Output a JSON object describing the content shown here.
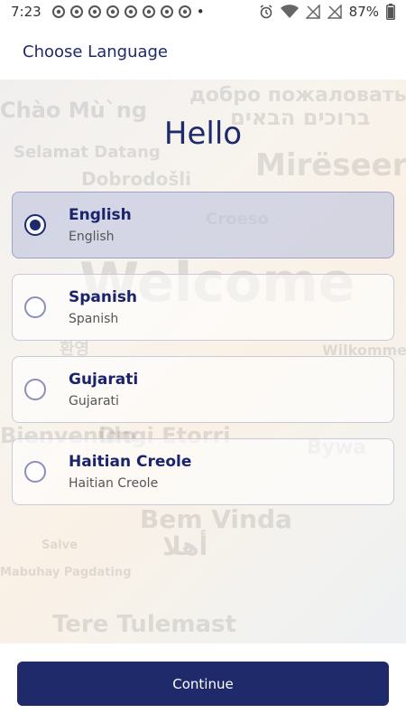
{
  "status_bar": {
    "time": "7:23",
    "battery": "87%",
    "notification_icons": [
      "chrome-icon",
      "chrome-icon",
      "chrome-icon",
      "chrome-icon",
      "chrome-icon",
      "chrome-icon",
      "chrome-icon",
      "chrome-icon"
    ],
    "more_dot": "•"
  },
  "header": {
    "title": "Choose Language"
  },
  "greeting": "Hello",
  "background_words": [
    "Welcome",
    "Bem Vinda",
    "Mirëseerdhët",
    "Dobrodošli",
    "Chào Mù`ng",
    "Selamat Datang",
    "Croeso",
    "Wilkommen",
    "Tere Tulemast",
    "Ongi Etorri",
    "Bienvenido",
    "Bywa",
    "Salve",
    "Mabuhay Pagdating",
    "добро пожаловать",
    "ברוכים הבאים",
    "أهلا",
    "환영"
  ],
  "languages": [
    {
      "name": "English",
      "native": "English",
      "selected": true
    },
    {
      "name": "Spanish",
      "native": "Spanish",
      "selected": false
    },
    {
      "name": "Gujarati",
      "native": "Gujarati",
      "selected": false
    },
    {
      "name": "Haitian Creole",
      "native": "Haitian Creole",
      "selected": false
    }
  ],
  "continue_label": "Continue",
  "colors": {
    "primary": "#1f2a6b",
    "selected_card": "#c4c8de"
  }
}
